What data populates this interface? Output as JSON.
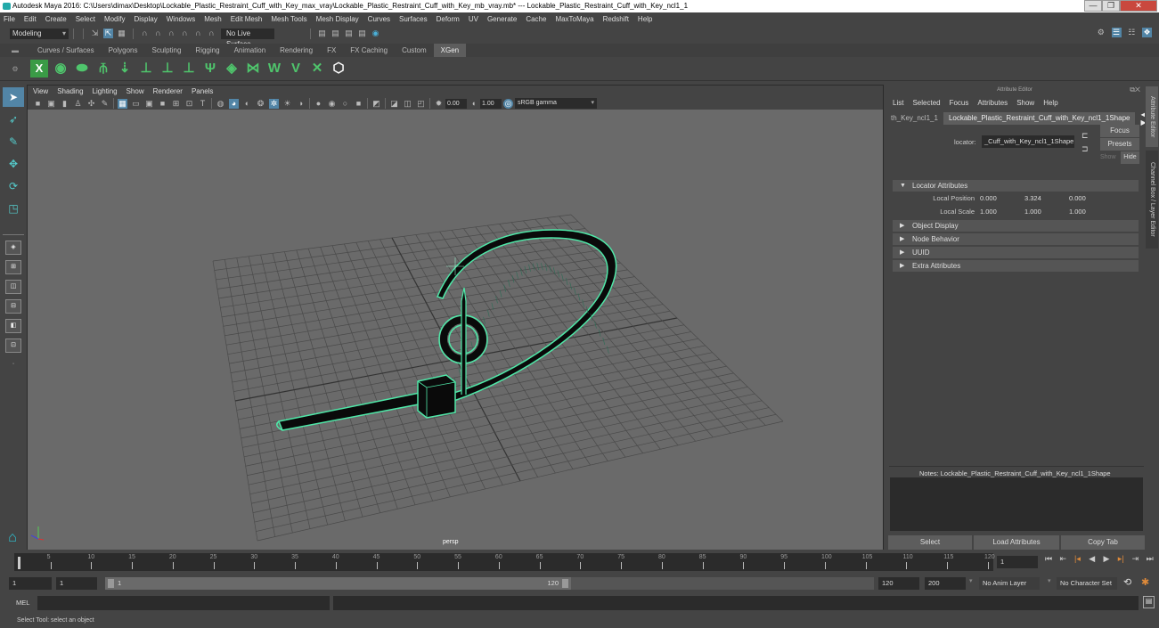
{
  "window": {
    "title": "Autodesk Maya 2016: C:\\Users\\dimax\\Desktop\\Lockable_Plastic_Restraint_Cuff_with_Key_max_vray\\Lockable_Plastic_Restraint_Cuff_with_Key_mb_vray.mb*   ---   Lockable_Plastic_Restraint_Cuff_with_Key_ncl1_1",
    "minimize": "—",
    "restore": "❐",
    "close": "✕"
  },
  "menubar": [
    "File",
    "Edit",
    "Create",
    "Select",
    "Modify",
    "Display",
    "Windows",
    "Mesh",
    "Edit Mesh",
    "Mesh Tools",
    "Mesh Display",
    "Curves",
    "Surfaces",
    "Deform",
    "UV",
    "Generate",
    "Cache",
    "MaxToMaya",
    "Redshift",
    "Help"
  ],
  "statusline": {
    "mode": "Modeling",
    "live_surface": "No Live Surface"
  },
  "shelf": {
    "tabs": [
      "Curves / Surfaces",
      "Polygons",
      "Sculpting",
      "Rigging",
      "Animation",
      "Rendering",
      "FX",
      "FX Caching",
      "Custom",
      "XGen"
    ],
    "active_tab": "XGen",
    "icons": [
      "xgen-description-icon",
      "xgen-preview-icon",
      "xgen-clear-preview-icon",
      "xgen-add-guides-icon",
      "xgen-place-guides-icon",
      "xgen-add-guide-icon",
      "xgen-sculpt-guides-icon",
      "xgen-lock-guides-icon",
      "xgen-grass-icon",
      "xgen-patch-icon",
      "xgen-select-guides-icon",
      "xgen-select-tool-icon",
      "xgen-flat-icon",
      "xgen-delete-icon",
      "xgen-logo-icon"
    ]
  },
  "viewport": {
    "menu": [
      "View",
      "Shading",
      "Lighting",
      "Show",
      "Renderer",
      "Panels"
    ],
    "exposure": "0.00",
    "gamma": "1.00",
    "color_space": "sRGB gamma",
    "camera_label": "persp",
    "wire_color": "#4fe8a8"
  },
  "attribute_editor": {
    "title": "Attribute Editor",
    "menu": [
      "List",
      "Selected",
      "Focus",
      "Attributes",
      "Show",
      "Help"
    ],
    "tabs": [
      "th_Key_ncl1_1",
      "Lockable_Plastic_Restraint_Cuff_with_Key_ncl1_1Shape"
    ],
    "active_tab": "Lockable_Plastic_Restraint_Cuff_with_Key_ncl1_1Shape",
    "locator_label": "locator:",
    "locator_value": "_Cuff_with_Key_ncl1_1Shape",
    "focus": "Focus",
    "presets": "Presets",
    "show": "Show",
    "hide": "Hide",
    "sections": [
      {
        "label": "Locator Attributes",
        "expanded": true
      },
      {
        "label": "Object Display",
        "expanded": false
      },
      {
        "label": "Node Behavior",
        "expanded": false
      },
      {
        "label": "UUID",
        "expanded": false
      },
      {
        "label": "Extra Attributes",
        "expanded": false
      }
    ],
    "local_position": {
      "label": "Local Position",
      "x": "0.000",
      "y": "3.324",
      "z": "0.000"
    },
    "local_scale": {
      "label": "Local Scale",
      "x": "1.000",
      "y": "1.000",
      "z": "1.000"
    },
    "notes_label": "Notes:  Lockable_Plastic_Restraint_Cuff_with_Key_ncl1_1Shape",
    "buttons": [
      "Select",
      "Load Attributes",
      "Copy Tab"
    ],
    "side_tabs": [
      "Attribute Editor",
      "Channel Box / Layer Editor"
    ]
  },
  "timeline": {
    "ticks": [
      5,
      10,
      15,
      20,
      25,
      30,
      35,
      40,
      45,
      50,
      55,
      60,
      65,
      70,
      75,
      80,
      85,
      90,
      95,
      100,
      105,
      110,
      115,
      120
    ],
    "current_frame": "1",
    "start": 1,
    "end": 120
  },
  "range": {
    "start_field": "1",
    "start_field2": "1",
    "slider_start": "1",
    "slider_end": "120",
    "end_field": "120",
    "end_field2": "200",
    "anim_layer": "No Anim Layer",
    "character_set": "No Character Set"
  },
  "command": {
    "lang": "MEL"
  },
  "help_line": "Select Tool: select an object"
}
